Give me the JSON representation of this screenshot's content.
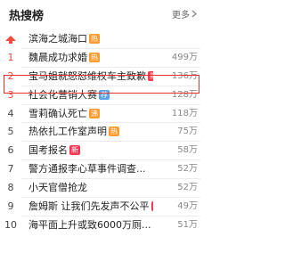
{
  "header": {
    "title": "热搜榜",
    "more_label": "更多"
  },
  "items": [
    {
      "rank": "",
      "title": "滨海之城海口",
      "badge": "热",
      "badge_type": "hot",
      "count": ""
    },
    {
      "rank": "1",
      "title": "魏晨成功求婚",
      "badge": "热",
      "badge_type": "hot",
      "count": "499万"
    },
    {
      "rank": "2",
      "title": "宝马姐就怒怼维权车主致歉",
      "badge": "新",
      "badge_type": "new",
      "count": "136万"
    },
    {
      "rank": "3",
      "title": "社会化营销大赛",
      "badge": "荐",
      "badge_type": "rec",
      "count": "128万"
    },
    {
      "rank": "4",
      "title": "雪莉确认死亡",
      "badge": "沸",
      "badge_type": "hot",
      "count": "118万"
    },
    {
      "rank": "5",
      "title": "热依扎工作室声明",
      "badge": "热",
      "badge_type": "hot",
      "count": "75万"
    },
    {
      "rank": "6",
      "title": "国考报名",
      "badge": "新",
      "badge_type": "new",
      "count": "58万"
    },
    {
      "rank": "7",
      "title": "警方通报李心草事件调查...",
      "badge": "",
      "badge_type": "",
      "count": "52万"
    },
    {
      "rank": "8",
      "title": "小天官僧抢龙",
      "badge": "",
      "badge_type": "",
      "count": "52万"
    },
    {
      "rank": "9",
      "title": "詹姆斯 让我们先发声不公平",
      "badge": "新",
      "badge_type": "new",
      "count": "49万"
    },
    {
      "rank": "10",
      "title": "海平面上升或致6000万厕...",
      "badge": "",
      "badge_type": "",
      "count": "51万"
    }
  ],
  "colors": {
    "accent_red": "#f04a3a",
    "hot": "#ff9a2e",
    "new": "#ff3852",
    "rec": "#5aa2ea"
  }
}
